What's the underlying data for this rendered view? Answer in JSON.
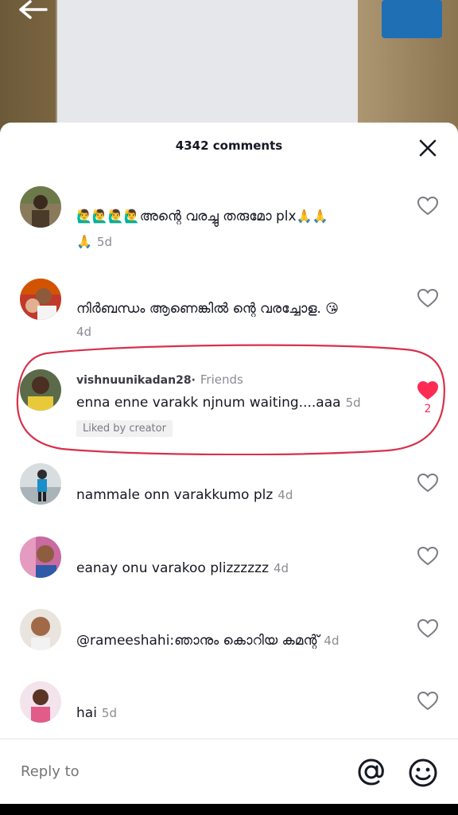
{
  "header": {
    "comment_count_label": "4342 comments"
  },
  "comments": [
    {
      "text_emoji": "🙋‍♂️🙋‍♂️🙋‍♂️🙋‍♂️",
      "text": "അന്റെ വരച്ചു തരുമോ plx",
      "text_emoji_end": "🙏🙏",
      "line2_emoji": "🙏",
      "time": "5d"
    },
    {
      "text": "നിർബന്ധം ആണെങ്കിൽ ന്റെ വരച്ചോള.",
      "text_emoji_end": "😘",
      "time": "4d"
    },
    {
      "username": "vishnuunikadan28·",
      "tag": "Friends",
      "text": "enna enne varakk njnum waiting....aaa",
      "time": "5d",
      "badge": "Liked by creator",
      "like_count": "2"
    },
    {
      "text": "nammale onn varakkumo plz",
      "time": "4d"
    },
    {
      "text": "eanay onu varakoo plizzzzzz",
      "time": "4d"
    },
    {
      "text": "@rameeshahi:ഞാനും കൊറിയ കമന്റ്",
      "time": "4d"
    },
    {
      "text": "hai",
      "time": "5d"
    }
  ],
  "reply": {
    "placeholder": "Reply to"
  },
  "colors": {
    "like_active": "#fe2c55",
    "highlight_ring": "#d9304a"
  }
}
